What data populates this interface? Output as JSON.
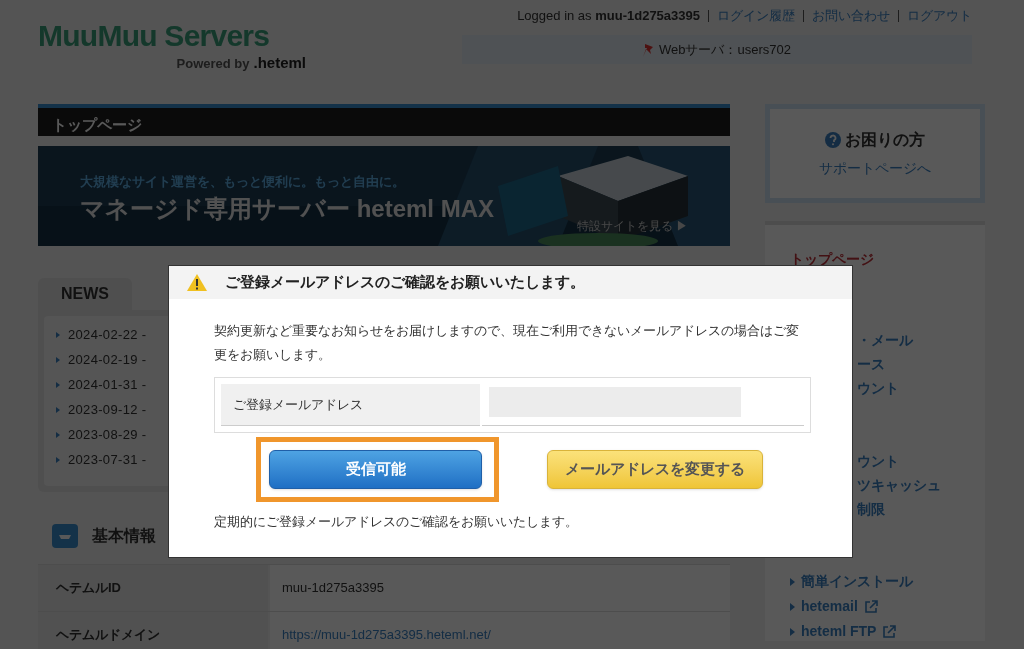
{
  "header": {
    "logo": {
      "title": "MuuMuu Servers",
      "powered_by": "Powered by",
      "brand": ".heteml"
    },
    "user_line": "Logged in as **muu-1d275a3395**",
    "links": [
      "ログイン履歴",
      "お問い合わせ",
      "ログアウト"
    ],
    "server": "Webサーバ：users702"
  },
  "main": {
    "page_title": "トップページ",
    "banner": {
      "tagline": "大規模なサイト運営を、もっと便利に。もっと自由に。",
      "headline": "マネージド専用サーバー heteml MAX",
      "link": "特設サイトを見る ▶"
    },
    "news": {
      "tab": "NEWS",
      "items": [
        "2024-02-22 -",
        "2024-02-19 -",
        "2024-01-31 -",
        "2023-09-12 -",
        "2023-08-29 -",
        "2023-07-31 -"
      ]
    },
    "basic_info": {
      "title": "基本情報",
      "rows": [
        {
          "label": "ヘテムルID",
          "value": "muu-1d275a3395",
          "kind": "text"
        },
        {
          "label": "ヘテムルドメイン",
          "value": "https://muu-1d275a3395.heteml.net/",
          "kind": "link"
        }
      ]
    }
  },
  "sidebar": {
    "help": {
      "title": "お困りの方",
      "link": "サポートページへ"
    },
    "menu": [
      {
        "label": "トップページ",
        "selected": true
      }
    ],
    "menu_group_1": [
      "・メール",
      "ース",
      "ウント"
    ],
    "menu_group_2": [
      "ウント",
      "ツキャッシュ",
      "制限"
    ],
    "tools": [
      {
        "label": "簡単インストール",
        "external": false
      },
      {
        "label": "hetemail",
        "external": true
      },
      {
        "label": "heteml FTP",
        "external": true
      }
    ]
  },
  "modal": {
    "title": "ご登録メールアドレスのご確認をお願いいたします。",
    "message": "契約更新など重要なお知らせをお届けしますので、現在ご利用できないメールアドレスの場合はご変更をお願いします。",
    "field_label": "ご登録メールアドレス",
    "buttons": [
      {
        "label": "受信可能",
        "kind": "primary",
        "highlighted": true
      },
      {
        "label": "メールアドレスを変更する",
        "kind": "secondary",
        "highlighted": false
      }
    ],
    "footer": "定期的にご登録メールアドレスのご確認をお願いいたします。"
  }
}
